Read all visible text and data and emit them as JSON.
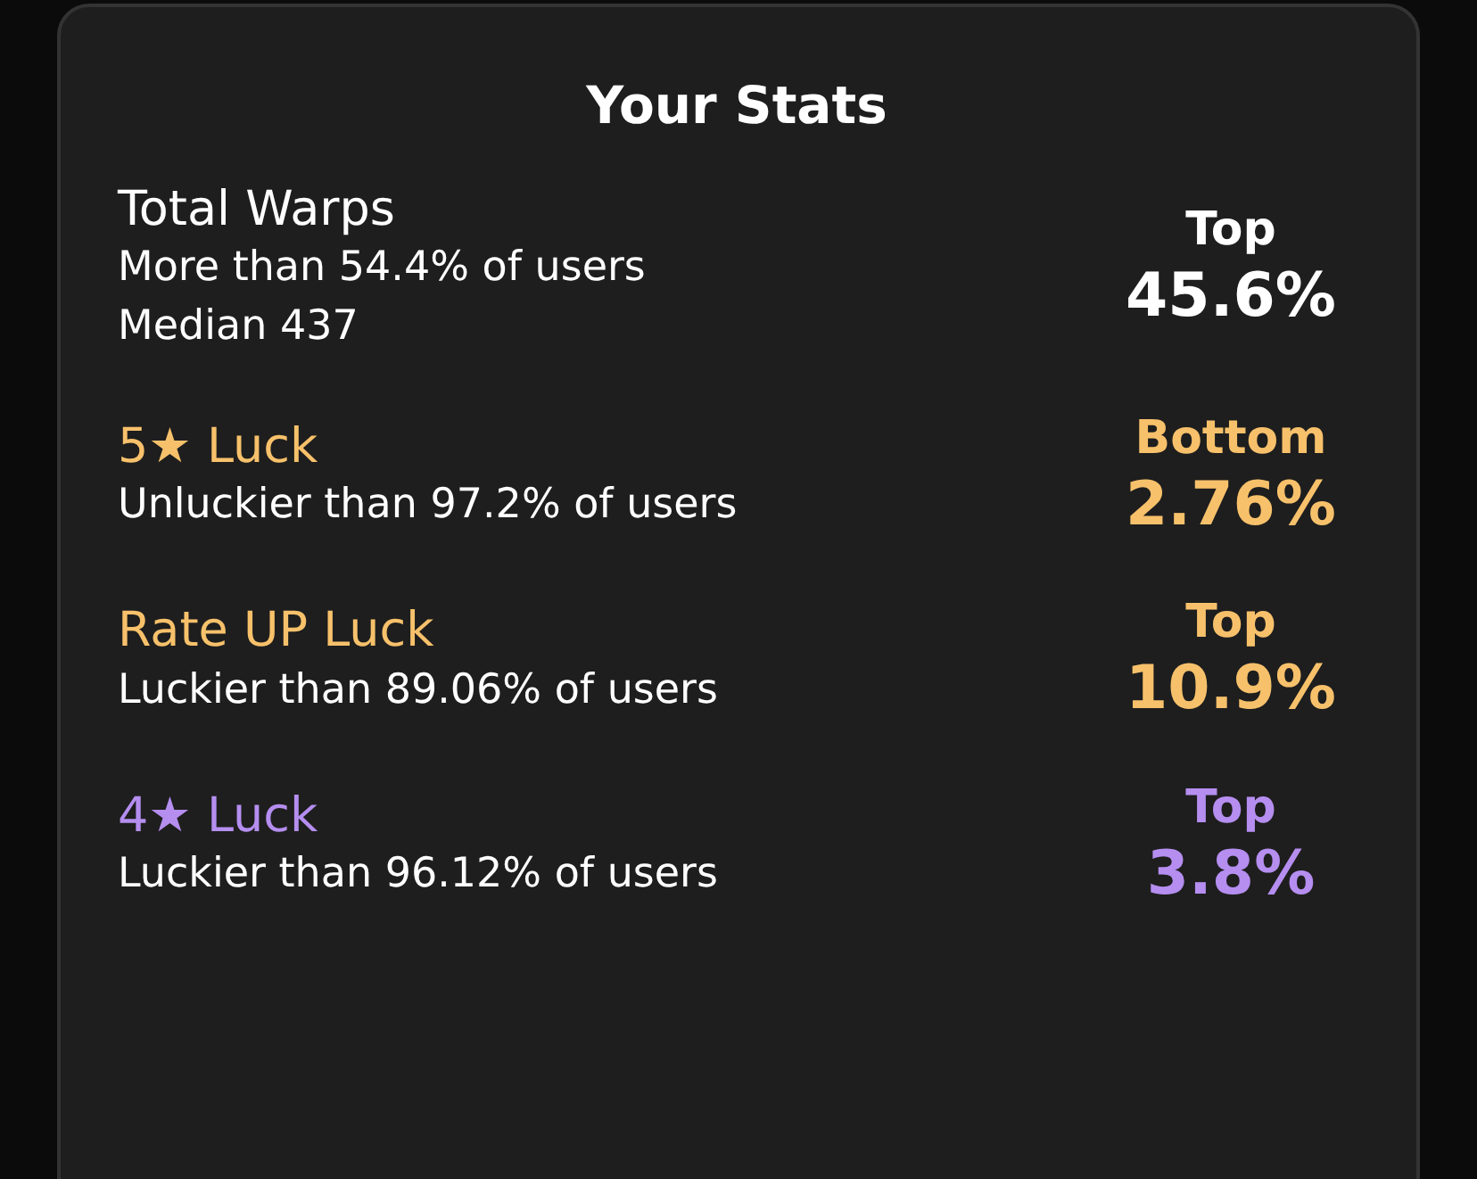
{
  "card": {
    "title": "Your Stats",
    "stats": [
      {
        "label": "Total Warps",
        "details": [
          "More than 54.4% of users",
          "Median 437"
        ],
        "rank_label": "Top",
        "rank_value": "45.6%",
        "color": "#ffffff"
      },
      {
        "label": "5★ Luck",
        "details": [
          "Unluckier than 97.2% of users"
        ],
        "rank_label": "Bottom",
        "rank_value": "2.76%",
        "color": "#f7c16b"
      },
      {
        "label": "Rate UP Luck",
        "details": [
          "Luckier than 89.06% of users"
        ],
        "rank_label": "Top",
        "rank_value": "10.9%",
        "color": "#f7c16b"
      },
      {
        "label": "4★ Luck",
        "details": [
          "Luckier than 96.12% of users"
        ],
        "rank_label": "Top",
        "rank_value": "3.8%",
        "color": "#b58ef0"
      }
    ]
  }
}
